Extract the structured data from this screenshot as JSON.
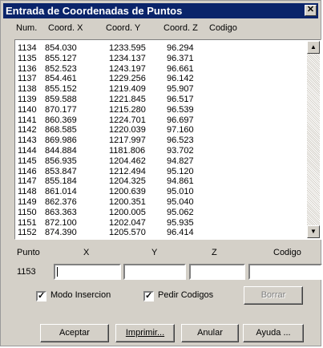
{
  "window": {
    "title": "Entrada de Coordenadas de Puntos",
    "close_glyph": "✕"
  },
  "list_headers": [
    "Num.",
    "Coord. X",
    "Coord. Y",
    "Coord. Z",
    "Codigo"
  ],
  "rows": [
    [
      "1134",
      "854.030",
      "1233.595",
      "96.294"
    ],
    [
      "1135",
      "855.127",
      "1234.137",
      "96.371"
    ],
    [
      "1136",
      "852.523",
      "1243.197",
      "96.661"
    ],
    [
      "1137",
      "854.461",
      "1229.256",
      "96.142"
    ],
    [
      "1138",
      "855.152",
      "1219.409",
      "95.907"
    ],
    [
      "1139",
      "859.588",
      "1221.845",
      "96.517"
    ],
    [
      "1140",
      "870.177",
      "1215.280",
      "96.539"
    ],
    [
      "1141",
      "860.369",
      "1224.701",
      "96.697"
    ],
    [
      "1142",
      "868.585",
      "1220.039",
      "97.160"
    ],
    [
      "1143",
      "869.986",
      "1217.997",
      "96.523"
    ],
    [
      "1144",
      "844.884",
      "1181.806",
      "93.702"
    ],
    [
      "1145",
      "856.935",
      "1204.462",
      "94.827"
    ],
    [
      "1146",
      "853.847",
      "1212.494",
      "95.120"
    ],
    [
      "1147",
      "855.184",
      "1204.325",
      "94.861"
    ],
    [
      "1148",
      "861.014",
      "1200.639",
      "95.010"
    ],
    [
      "1149",
      "862.376",
      "1200.351",
      "95.040"
    ],
    [
      "1150",
      "863.363",
      "1200.005",
      "95.062"
    ],
    [
      "1151",
      "872.100",
      "1202.047",
      "95.935"
    ],
    [
      "1152",
      "874.390",
      "1205.570",
      "96.414"
    ]
  ],
  "entry": {
    "labels": {
      "punto": "Punto",
      "x": "X",
      "y": "Y",
      "z": "Z",
      "codigo": "Codigo"
    },
    "point_number": "1153",
    "x_value": "",
    "y_value": "",
    "z_value": "",
    "codigo_value": ""
  },
  "options": {
    "modo_insercion": {
      "label": "Modo Insercion",
      "checked": true
    },
    "pedir_codigos": {
      "label": "Pedir Codigos",
      "checked": true
    }
  },
  "buttons": {
    "borrar": "Borrar",
    "aceptar": "Aceptar",
    "imprimir": "Imprimir...",
    "anular": "Anular",
    "ayuda": "Ayuda ..."
  },
  "icons": {
    "scroll_up": "▲",
    "scroll_down": "▼",
    "check": "✓"
  }
}
